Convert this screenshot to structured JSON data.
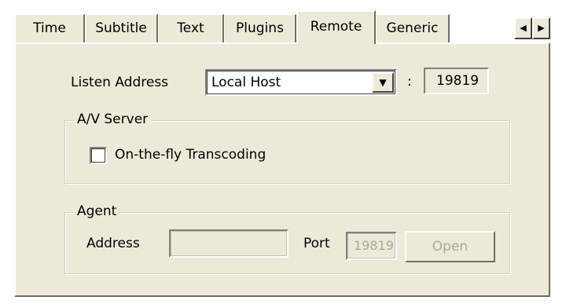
{
  "tabs": [
    {
      "label": "Time"
    },
    {
      "label": "Subtitle"
    },
    {
      "label": "Text"
    },
    {
      "label": "Plugins"
    },
    {
      "label": "Remote",
      "active": true
    },
    {
      "label": "Generic"
    }
  ],
  "tab_scroll": {
    "left_icon": "arrow-left-icon",
    "right_icon": "arrow-right-icon"
  },
  "remote": {
    "listen_address_label": "Listen Address",
    "listen_address_value": "Local Host",
    "separator": ":",
    "listen_port_value": "19819",
    "av_server": {
      "title": "A/V Server",
      "transcoding_label": "On-the-fly Transcoding",
      "transcoding_checked": false
    },
    "agent": {
      "title": "Agent",
      "address_label": "Address",
      "address_value": "",
      "port_label": "Port",
      "port_value": "1981\u0000",
      "open_button": "Open"
    }
  },
  "colors": {
    "dialog_bg": "#ece9d8",
    "disabled_text": "#aca899"
  }
}
